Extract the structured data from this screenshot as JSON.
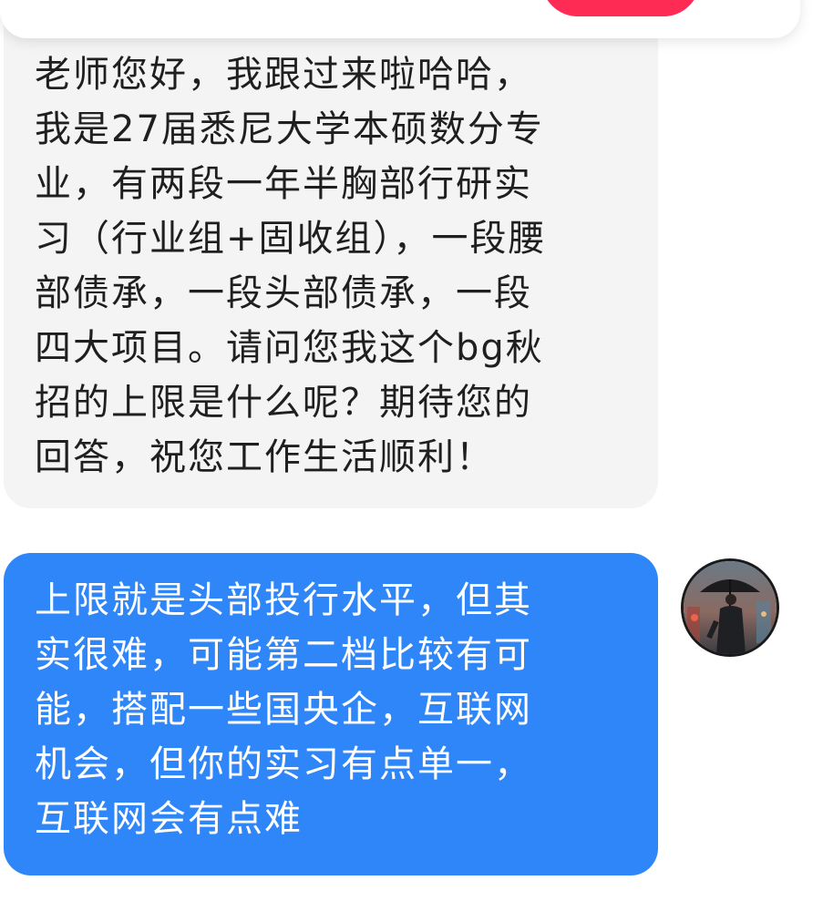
{
  "chat": {
    "messages": [
      {
        "sender": "incoming",
        "text": "老师您好，我跟过来啦哈哈，\n我是27届悉尼大学本硕数分专\n业，有两段一年半胸部行研实\n习（行业组+固收组），一段腰\n部债承，一段头部债承，一段\n四大项目。请问您我这个bg秋\n招的上限是什么呢？期待您的\n回答，祝您工作生活顺利！"
      },
      {
        "sender": "self",
        "text": "上限就是头部投行水平，但其\n实很难，可能第二档比较有可\n能，搭配一些国央企，互联网\n机会，但你的实习有点单一，\n互联网会有点难"
      }
    ]
  },
  "colors": {
    "incoming_bubble": "#f4f4f4",
    "outgoing_bubble": "#2e86f9",
    "accent_red": "#fe2c55"
  }
}
